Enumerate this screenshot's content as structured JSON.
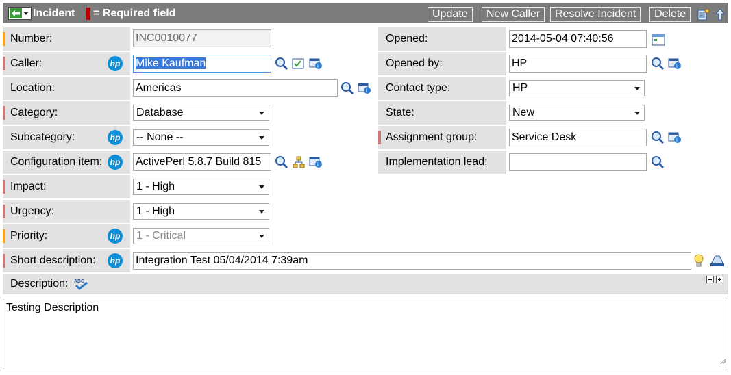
{
  "header": {
    "title": "Incident",
    "required_legend": "= Required field",
    "buttons": {
      "update": "Update",
      "new_caller": "New Caller",
      "resolve_incident": "Resolve Incident",
      "delete": "Delete"
    }
  },
  "left": {
    "number": {
      "label": "Number:",
      "value": "INC0010077"
    },
    "caller": {
      "label": "Caller:",
      "value": "Mike Kaufman"
    },
    "location": {
      "label": "Location:",
      "value": "Americas"
    },
    "category": {
      "label": "Category:",
      "value": "Database"
    },
    "subcategory": {
      "label": "Subcategory:",
      "value": "-- None --"
    },
    "configuration_item": {
      "label": "Configuration item:",
      "value": "ActivePerl 5.8.7 Build 815"
    },
    "impact": {
      "label": "Impact:",
      "value": "1 - High"
    },
    "urgency": {
      "label": "Urgency:",
      "value": "1 - High"
    },
    "priority": {
      "label": "Priority:",
      "value": "1 - Critical"
    },
    "short_description": {
      "label": "Short description:",
      "value": "Integration Test 05/04/2014 7:39am"
    }
  },
  "right": {
    "opened": {
      "label": "Opened:",
      "value": "2014-05-04 07:40:56"
    },
    "opened_by": {
      "label": "Opened by:",
      "value": "HP"
    },
    "contact_type": {
      "label": "Contact type:",
      "value": "HP"
    },
    "state": {
      "label": "State:",
      "value": "New"
    },
    "assignment_group": {
      "label": "Assignment group:",
      "value": "Service Desk"
    },
    "implementation_lead": {
      "label": "Implementation lead:",
      "value": ""
    }
  },
  "description": {
    "label": "Description:",
    "value": "Testing Description"
  },
  "hp_badge": "hp",
  "colors": {
    "titlebar": "#7c7c7c",
    "required": "#c00000",
    "mandatory_bar": "#c77a7a",
    "priority_bar": "#f2a51b",
    "hp_blue": "#0f8fd9"
  }
}
